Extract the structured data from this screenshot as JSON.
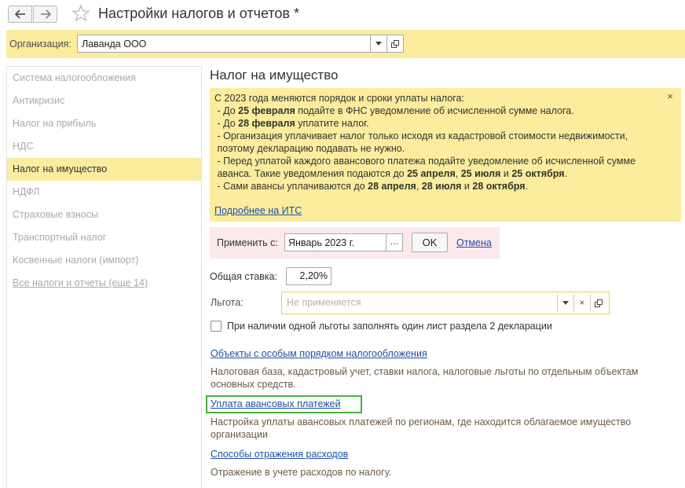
{
  "window": {
    "title": "Настройки налогов и отчетов *"
  },
  "org": {
    "label": "Организация:",
    "value": "Лаванда ООО"
  },
  "sidebar": {
    "items": [
      {
        "label": "Система налогообложения",
        "active": false
      },
      {
        "label": "Антикризис",
        "active": false
      },
      {
        "label": "Налог на прибыль",
        "active": false
      },
      {
        "label": "НДС",
        "active": false
      },
      {
        "label": "Налог на имущество",
        "active": true
      },
      {
        "label": "НДФЛ",
        "active": false
      },
      {
        "label": "Страховые взносы",
        "active": false
      },
      {
        "label": "Транспортный налог",
        "active": false
      },
      {
        "label": "Косвенные налоги (импорт)",
        "active": false
      },
      {
        "label": "Все налоги и отчеты (еще 14)",
        "active": false
      }
    ]
  },
  "main": {
    "title": "Налог на имущество",
    "info": {
      "close": "×",
      "lines": [
        [
          {
            "t": "С 2023 года меняются порядок и сроки уплаты налога:"
          }
        ],
        [
          {
            "t": " - До "
          },
          {
            "t": "25 февраля",
            "b": true
          },
          {
            "t": " подайте в ФНС уведомление об исчисленной сумме налога."
          }
        ],
        [
          {
            "t": " - До "
          },
          {
            "t": "28 февраля",
            "b": true
          },
          {
            "t": " уплатите налог."
          }
        ],
        [
          {
            "t": " - Организация уплачивает налог только исходя из кадастровой стоимости недвижимости,"
          }
        ],
        [
          {
            "t": " поэтому декларацию подавать не нужно."
          }
        ],
        [
          {
            "t": " - Перед уплатой каждого авансового платежа подайте уведомление об исчисленной сумме"
          }
        ],
        [
          {
            "t": " аванса. Такие уведомления подаются до "
          },
          {
            "t": "25 апреля",
            "b": true
          },
          {
            "t": ", "
          },
          {
            "t": "25 июля",
            "b": true
          },
          {
            "t": " и "
          },
          {
            "t": "25 октября",
            "b": true
          },
          {
            "t": "."
          }
        ],
        [
          {
            "t": " - Сами авансы уплачиваются до "
          },
          {
            "t": "28 апреля",
            "b": true
          },
          {
            "t": ", "
          },
          {
            "t": "28 июля",
            "b": true
          },
          {
            "t": " и "
          },
          {
            "t": "28 октября",
            "b": true
          },
          {
            "t": "."
          }
        ]
      ],
      "link": "Подробнее на ИТС"
    },
    "apply": {
      "label": "Применить с:",
      "value": "Январь 2023 г.",
      "dots": "...",
      "ok": "OK",
      "cancel": "Отмена"
    },
    "rate": {
      "label": "Общая ставка:",
      "value": "2,20%"
    },
    "benefit": {
      "label": "Льгота:",
      "placeholder": "Не применяется",
      "clear": "×"
    },
    "checkbox": {
      "label": "При наличии одной льготы заполнять один лист раздела 2 декларации",
      "checked": false
    },
    "links": [
      {
        "label": "Объекты с особым порядком налогообложения",
        "desc": "Налоговая база, кадастровый учет, ставки налога, налоговые льготы по отдельным объектам основных средств."
      },
      {
        "label": "Уплата авансовых платежей",
        "desc": "Настройка уплаты авансовых платежей по регионам, где находится облагаемое имущество организации"
      },
      {
        "label": "Способы отражения расходов",
        "desc": "Отражение в учете расходов по налогу."
      }
    ]
  },
  "colors": {
    "accent_yellow": "#fbec9e",
    "apply_pink": "#fbe9ec",
    "link_blue": "#1d4fa8",
    "focus_yellow": "#f0cd3c",
    "highlight_green": "#46b33a"
  }
}
